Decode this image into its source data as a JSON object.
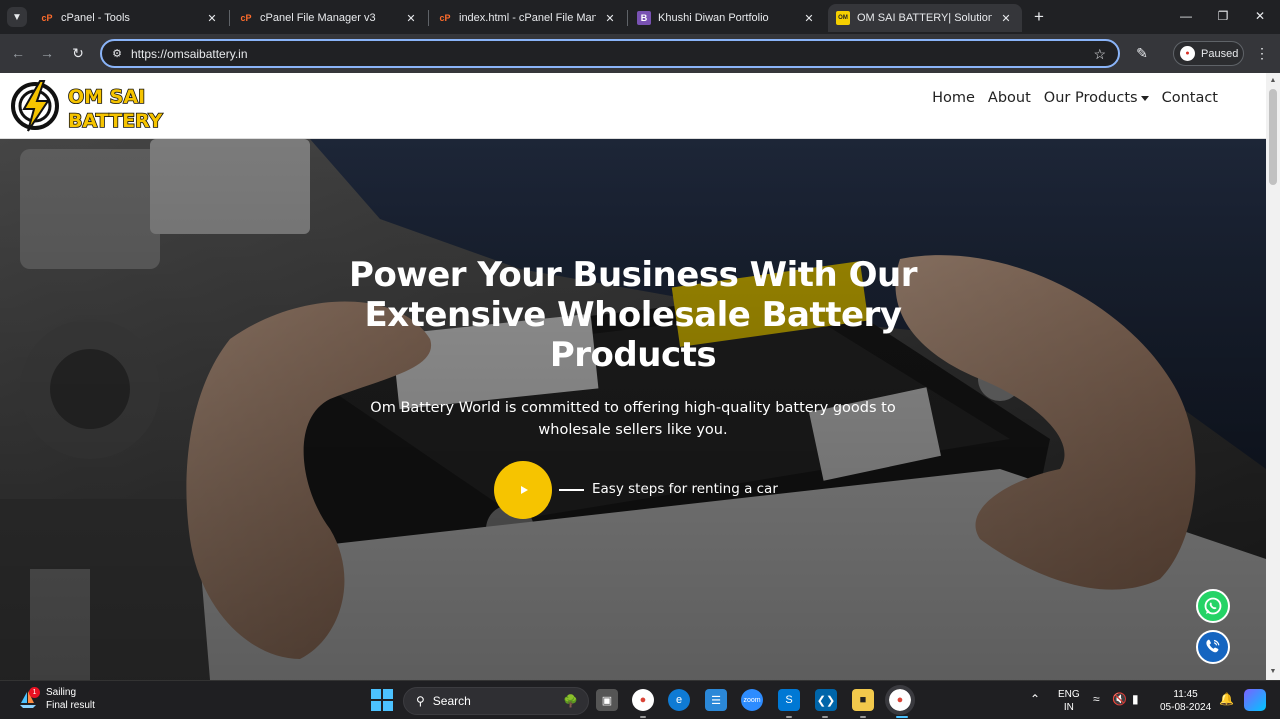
{
  "browser": {
    "tabs": [
      {
        "title": "cPanel - Tools",
        "favicon": "cpanel-icon"
      },
      {
        "title": "cPanel File Manager v3",
        "favicon": "cpanel-icon"
      },
      {
        "title": "index.html - cPanel File Manager",
        "favicon": "cpanel-icon"
      },
      {
        "title": "Khushi Diwan Portfolio",
        "favicon": "bootstrap-icon"
      },
      {
        "title": "OM SAI BATTERY| Solution for all",
        "favicon": "om-sai-battery-icon",
        "active": true
      }
    ],
    "url": "https://omsaibattery.in",
    "profile_label": "Paused"
  },
  "site": {
    "nav": {
      "home": "Home",
      "about": "About",
      "products": "Our Products",
      "contact": "Contact"
    },
    "hero": {
      "title": "Power Your Business With Our Extensive Wholesale Battery Products",
      "subtitle": "Om Battery World is committed to offering high-quality battery goods to wholesale sellers like you.",
      "cta_label": "Easy steps for renting a car"
    },
    "colors": {
      "accent": "#f6c400",
      "whatsapp": "#25d366",
      "call": "#1565c0"
    }
  },
  "taskbar": {
    "weather_title": "Sailing",
    "weather_sub": "Final result",
    "weather_badge": "1",
    "search_label": "Search",
    "lang_line1": "ENG",
    "lang_line2": "IN",
    "time": "11:45",
    "date": "05-08-2024"
  }
}
